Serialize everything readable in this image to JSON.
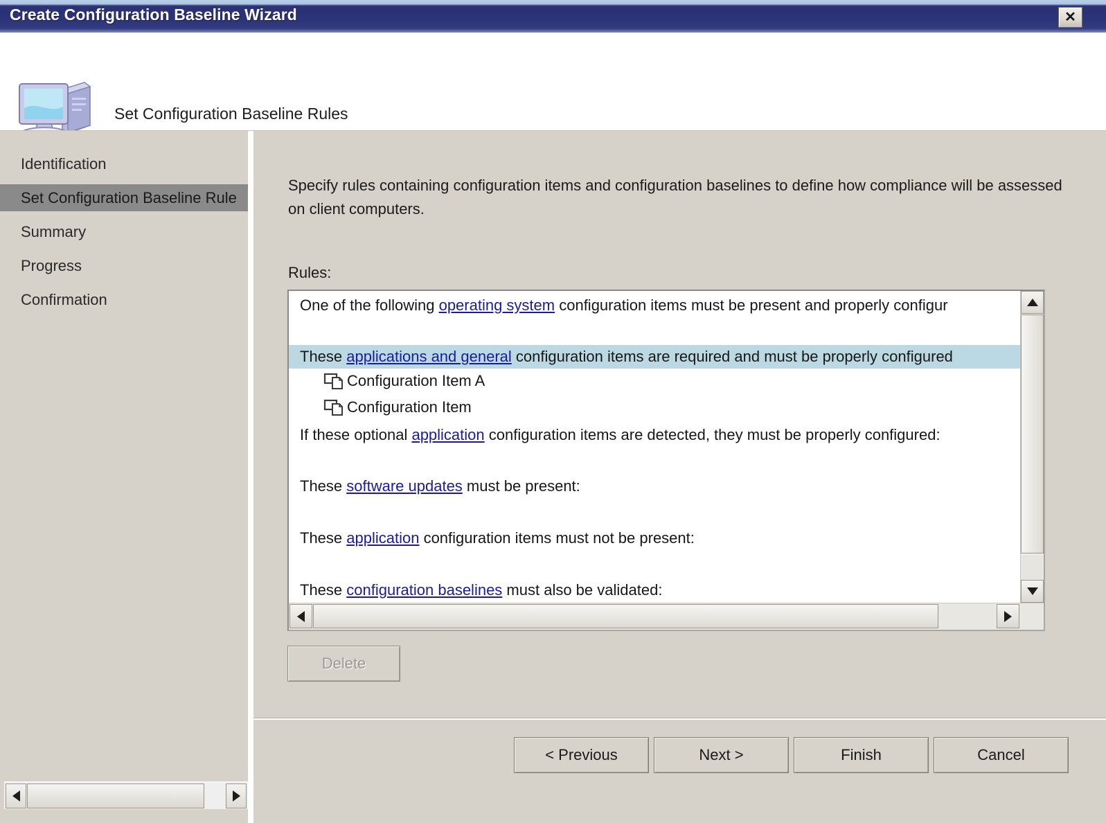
{
  "window": {
    "title": "Create Configuration Baseline Wizard",
    "close_label": "✕"
  },
  "header": {
    "icon": "computer-icon",
    "title": "Set Configuration Baseline Rules"
  },
  "sidebar": {
    "items": [
      {
        "label": "Identification",
        "selected": false
      },
      {
        "label": "Set Configuration Baseline Rule",
        "selected": true
      },
      {
        "label": "Summary",
        "selected": false
      },
      {
        "label": "Progress",
        "selected": false
      },
      {
        "label": "Confirmation",
        "selected": false
      }
    ],
    "scrollbar": {
      "left_arrow": "◄",
      "right_arrow": "►"
    }
  },
  "main": {
    "intro": "Specify rules containing configuration items and configuration baselines to define how compliance will be assessed on client computers.",
    "rules_label": "Rules:",
    "rules": [
      {
        "id": "rule-operating-system",
        "prefix": "One of the following ",
        "link": "operating system",
        "suffix": " configuration items must be present and properly configur",
        "highlight": false
      },
      {
        "id": "rule-applications-and-general",
        "prefix": "These ",
        "link": "applications and general",
        "suffix": " configuration items are required and must be properly configured",
        "highlight": true
      },
      {
        "id": "rule-optional-application",
        "prefix": "If these optional ",
        "link": "application",
        "suffix": " configuration items are detected, they must be properly configured:",
        "highlight": false
      },
      {
        "id": "rule-software-updates",
        "prefix": "These ",
        "link": "software updates",
        "suffix": " must be present:",
        "highlight": false
      },
      {
        "id": "rule-application-not-present",
        "prefix": "These ",
        "link": "application",
        "suffix": " configuration items must not be present:",
        "highlight": false
      },
      {
        "id": "rule-configuration-baselines",
        "prefix": "These ",
        "link": "configuration baselines",
        "suffix": " must also be validated:",
        "highlight": false
      }
    ],
    "configuration_items": [
      {
        "label": "Configuration Item A",
        "icon": "configuration-item-icon"
      },
      {
        "label": "Configuration Item",
        "icon": "configuration-item-icon"
      }
    ],
    "delete_label": "Delete",
    "scrollbars": {
      "up_arrow": "▲",
      "down_arrow": "▼",
      "left_arrow": "◄",
      "right_arrow": "►"
    }
  },
  "footer": {
    "previous_label": "< Previous",
    "next_label": "Next >",
    "finish_label": "Finish",
    "cancel_label": "Cancel"
  },
  "colors": {
    "titlebar": "#2c3378",
    "panel": "#d6d2ca",
    "selection_sidebar": "#8a8a8a",
    "selection_row": "#bcd9e3",
    "link": "#1b1b9e"
  }
}
